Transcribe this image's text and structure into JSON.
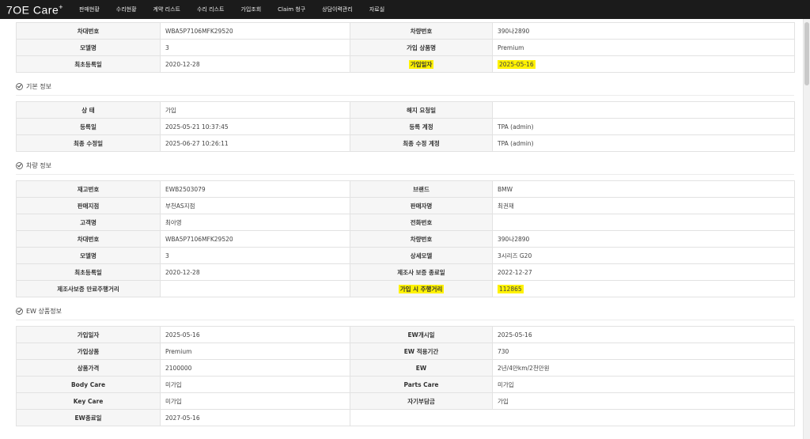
{
  "nav": {
    "logo": "7OE Care",
    "logo_sup": "+",
    "items": [
      "판매현황",
      "수리현황",
      "계약 리스트",
      "수리 리스트",
      "가입조회",
      "Claim 청구",
      "상담이력관리",
      "자료실"
    ]
  },
  "top": {
    "rows": [
      [
        "차대번호",
        "WBA5P7106MFK29520",
        "차량번호",
        "390나2890"
      ],
      [
        "모델명",
        "3",
        "가입 상품명",
        "Premium"
      ],
      [
        "최초등록일",
        "2020-12-28",
        "가입일자",
        "2025-05-16"
      ]
    ]
  },
  "basic": {
    "title": "기본 정보",
    "rows": [
      [
        "상 태",
        "가입",
        "해지 요청일",
        ""
      ],
      [
        "등록일",
        "2025-05-21 10:37:45",
        "등록 계정",
        "TPA (admin)"
      ],
      [
        "최종 수정일",
        "2025-06-27 10:26:11",
        "최종 수정 계정",
        "TPA (admin)"
      ]
    ]
  },
  "vehicle": {
    "title": "차량 정보",
    "rows": [
      [
        "재고번호",
        "EWB2503079",
        "브랜드",
        "BMW"
      ],
      [
        "판매지점",
        "부천AS지점",
        "판매자명",
        "최권재"
      ],
      [
        "고객명",
        "최아영",
        "전화번호",
        ""
      ],
      [
        "차대번호",
        "WBA5P7106MFK29520",
        "차량번호",
        "390나2890"
      ],
      [
        "모델명",
        "3",
        "상세모델",
        "3시리즈 G20"
      ],
      [
        "최초등록일",
        "2020-12-28",
        "제조사 보증 종료일",
        "2022-12-27"
      ],
      [
        "제조사보증 만료주행거리",
        "",
        "가입 시 주행거리",
        "112865"
      ]
    ]
  },
  "ew": {
    "title": "EW 상품정보",
    "rows": [
      [
        "가입일자",
        "2025-05-16",
        "EW개시일",
        "2025-05-16"
      ],
      [
        "가입상품",
        "Premium",
        "EW 적용기간",
        "730"
      ],
      [
        "상품가격",
        "2100000",
        "EW",
        "2년/4만km/2천만원"
      ],
      [
        "Body Care",
        "미가입",
        "Parts Care",
        "미가입"
      ],
      [
        "Key Care",
        "미가입",
        "자기부담금",
        "가입"
      ],
      [
        "EW종료일",
        "2027-05-16",
        "",
        ""
      ]
    ]
  }
}
